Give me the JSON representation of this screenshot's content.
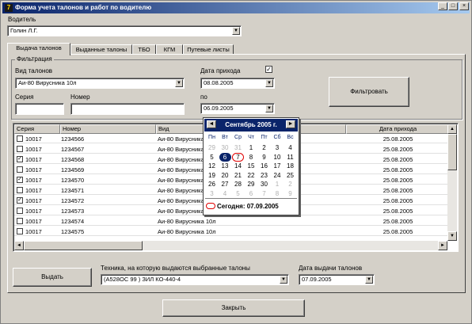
{
  "window": {
    "title": "Форма учета талонов и работ по водителю"
  },
  "driver": {
    "label": "Водитель",
    "value": "Голин Л.Г."
  },
  "tabs": [
    {
      "label": "Выдача талонов",
      "active": true
    },
    {
      "label": "Выданные талоны"
    },
    {
      "label": "ТБО"
    },
    {
      "label": "КГМ"
    },
    {
      "label": "Путевые листы"
    }
  ],
  "filter": {
    "group_title": "Фильтрация",
    "type_label": "Вид талонов",
    "type_value": "Аи-80 Вирусника 10л",
    "series_label": "Серия",
    "number_label": "Номер",
    "date_label": "Дата прихода",
    "date_from": "08.08.2005",
    "to_label": "по",
    "date_to": "06.09.2005",
    "date_checked": true,
    "check_mark": "✓",
    "button": "Фильтровать"
  },
  "grid": {
    "columns": [
      "Серия",
      "Номер",
      "Вид",
      "Дата прихода"
    ],
    "rows": [
      {
        "checked": false,
        "series": "10017",
        "number": "1234566",
        "type": "Аи-80 Вирусника 10л",
        "date": "25.08.2005"
      },
      {
        "checked": false,
        "series": "10017",
        "number": "1234567",
        "type": "Аи-80 Вирусника 10л",
        "date": "25.08.2005"
      },
      {
        "checked": true,
        "series": "10017",
        "number": "1234568",
        "type": "Аи-80 Вирусника 10л",
        "date": "25.08.2005"
      },
      {
        "checked": false,
        "series": "10017",
        "number": "1234569",
        "type": "Аи-80 Вирусника 10л",
        "date": "25.08.2005"
      },
      {
        "checked": true,
        "series": "10017",
        "number": "1234570",
        "type": "Аи-80 Вирусника 10л",
        "date": "25.08.2005"
      },
      {
        "checked": false,
        "series": "10017",
        "number": "1234571",
        "type": "Аи-80 Вирусника 10л",
        "date": "25.08.2005"
      },
      {
        "checked": true,
        "series": "10017",
        "number": "1234572",
        "type": "Аи-80 Вирусника 10л",
        "date": "25.08.2005"
      },
      {
        "checked": false,
        "series": "10017",
        "number": "1234573",
        "type": "Аи-80 Вирусника 10л",
        "date": "25.08.2005"
      },
      {
        "checked": false,
        "series": "10017",
        "number": "1234574",
        "type": "Аи-80 Вирусника 10л",
        "date": "25.08.2005"
      },
      {
        "checked": false,
        "series": "10017",
        "number": "1234575",
        "type": "Аи-80 Вирусника 10л",
        "date": "25.08.2005"
      }
    ]
  },
  "calendar": {
    "month_title": "Сентябрь 2005 г.",
    "weekdays": [
      "Пн",
      "Вт",
      "Ср",
      "Чт",
      "Пт",
      "Сб",
      "Вс"
    ],
    "weeks": [
      [
        {
          "d": "29",
          "o": true
        },
        {
          "d": "30",
          "o": true
        },
        {
          "d": "31",
          "o": true
        },
        {
          "d": "1"
        },
        {
          "d": "2"
        },
        {
          "d": "3"
        },
        {
          "d": "4"
        }
      ],
      [
        {
          "d": "5"
        },
        {
          "d": "6",
          "sel": true
        },
        {
          "d": "7",
          "today": true
        },
        {
          "d": "8"
        },
        {
          "d": "9"
        },
        {
          "d": "10"
        },
        {
          "d": "11"
        }
      ],
      [
        {
          "d": "12"
        },
        {
          "d": "13"
        },
        {
          "d": "14"
        },
        {
          "d": "15"
        },
        {
          "d": "16"
        },
        {
          "d": "17"
        },
        {
          "d": "18"
        }
      ],
      [
        {
          "d": "19"
        },
        {
          "d": "20"
        },
        {
          "d": "21"
        },
        {
          "d": "22"
        },
        {
          "d": "23"
        },
        {
          "d": "24"
        },
        {
          "d": "25"
        }
      ],
      [
        {
          "d": "26"
        },
        {
          "d": "27"
        },
        {
          "d": "28"
        },
        {
          "d": "29"
        },
        {
          "d": "30"
        },
        {
          "d": "1",
          "o": true
        },
        {
          "d": "2",
          "o": true
        }
      ],
      [
        {
          "d": "3",
          "o": true
        },
        {
          "d": "4",
          "o": true
        },
        {
          "d": "5",
          "o": true
        },
        {
          "d": "6",
          "o": true
        },
        {
          "d": "7",
          "o": true
        },
        {
          "d": "8",
          "o": true
        },
        {
          "d": "9",
          "o": true
        }
      ]
    ],
    "today_text": "Сегодня: 07.09.2005"
  },
  "bottom": {
    "issue_button": "Выдать",
    "vehicle_label": "Техника, на которую выдаются выбранные талоны",
    "vehicle_value": "(А528ОС 99 ) ЗИЛ КО-440-4",
    "issue_date_label": "Дата выдачи талонов",
    "issue_date_value": "07.09.2005",
    "close_button": "Закрыть"
  }
}
